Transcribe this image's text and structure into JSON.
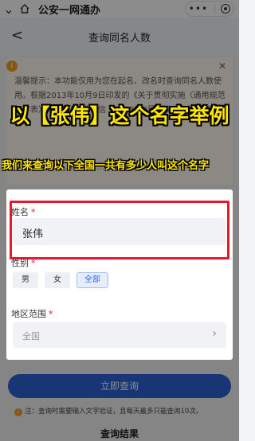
{
  "app": {
    "title": "公安一网通办",
    "capsule_menu_icon": "more-dots-icon",
    "capsule_close_icon": "target-close-icon"
  },
  "header": {
    "title": "查询同名人数"
  },
  "notice": {
    "text1": "温馨提示：本功能仅用为您在起名、改名时查询同名人数使用。根据2013年10月9日印发的《关于贯彻实施〈通用规范汉字表〉的通知》（教语信〔2013〕2号）规定，姓名登记",
    "text2": "…………………………………………"
  },
  "overlay": {
    "caption_big": "以【张伟】这个名字举例",
    "caption_small": "我们来查询以下全国一共有多少人叫这个名字"
  },
  "form": {
    "name_label": "姓名",
    "name_required": "*",
    "name_value": "张伟",
    "gender_label": "性别",
    "gender_required": "*",
    "gender_options": [
      "男",
      "女",
      "全部"
    ],
    "gender_selected": "全部",
    "region_label": "地区范围",
    "region_required": "*",
    "region_value": "全国"
  },
  "actions": {
    "query_label": "立即查询"
  },
  "note": {
    "text": "注：查询时需要输入文字验证，且每天最多只能查询10次。"
  },
  "results": {
    "title": "查询结果"
  },
  "colors": {
    "accent": "#2d62d8",
    "highlight": "#e8192c",
    "caption": "#ffe600"
  }
}
